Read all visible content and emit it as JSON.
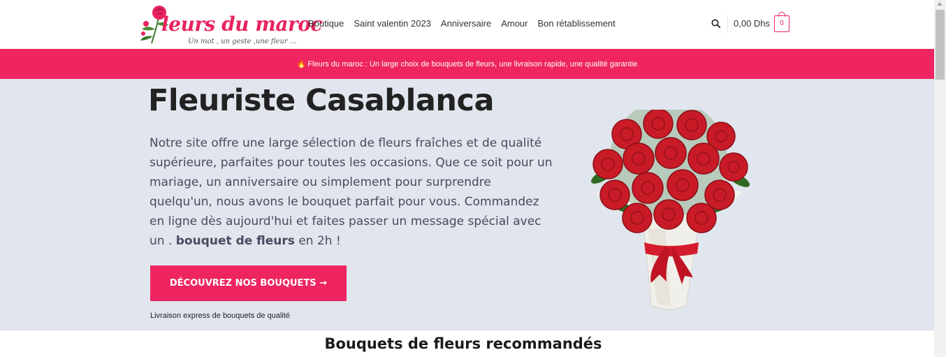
{
  "header": {
    "logo_text": "leurs du maroc",
    "logo_tagline": "Un mot , un geste ,une fleur ...",
    "nav": [
      "Boutique",
      "Saint valentin 2023",
      "Anniversaire",
      "Amour",
      "Bon rétablissement"
    ],
    "cart_total": "0,00 Dhs",
    "cart_count": "0"
  },
  "promo": {
    "text": "Fleurs du maroc : Un large choix de bouquets de fleurs, une livraison rapide, une qualité garantie"
  },
  "hero": {
    "title": "Fleuriste Casablanca",
    "desc_main": "Notre site offre une large sélection de fleurs fraîches et de qualité supérieure, parfaites pour toutes les occasions. Que ce soit pour un mariage, un anniversaire ou simplement pour surprendre quelqu'un, nous avons le bouquet parfait pour vous. Commandez en ligne dès aujourd'hui et faites passer un message spécial avec un . ",
    "desc_bold": "bouquet de fleurs",
    "desc_end": " en 2h !",
    "cta_label": "DÉCOUVREZ NOS BOUQUETS →",
    "delivery_note": "Livraison express de bouquets de qualité"
  },
  "section": {
    "title": "Bouquets de fleurs recommandés"
  },
  "colors": {
    "brand": "#ee2560",
    "hero_bg": "#e1e5ed"
  }
}
